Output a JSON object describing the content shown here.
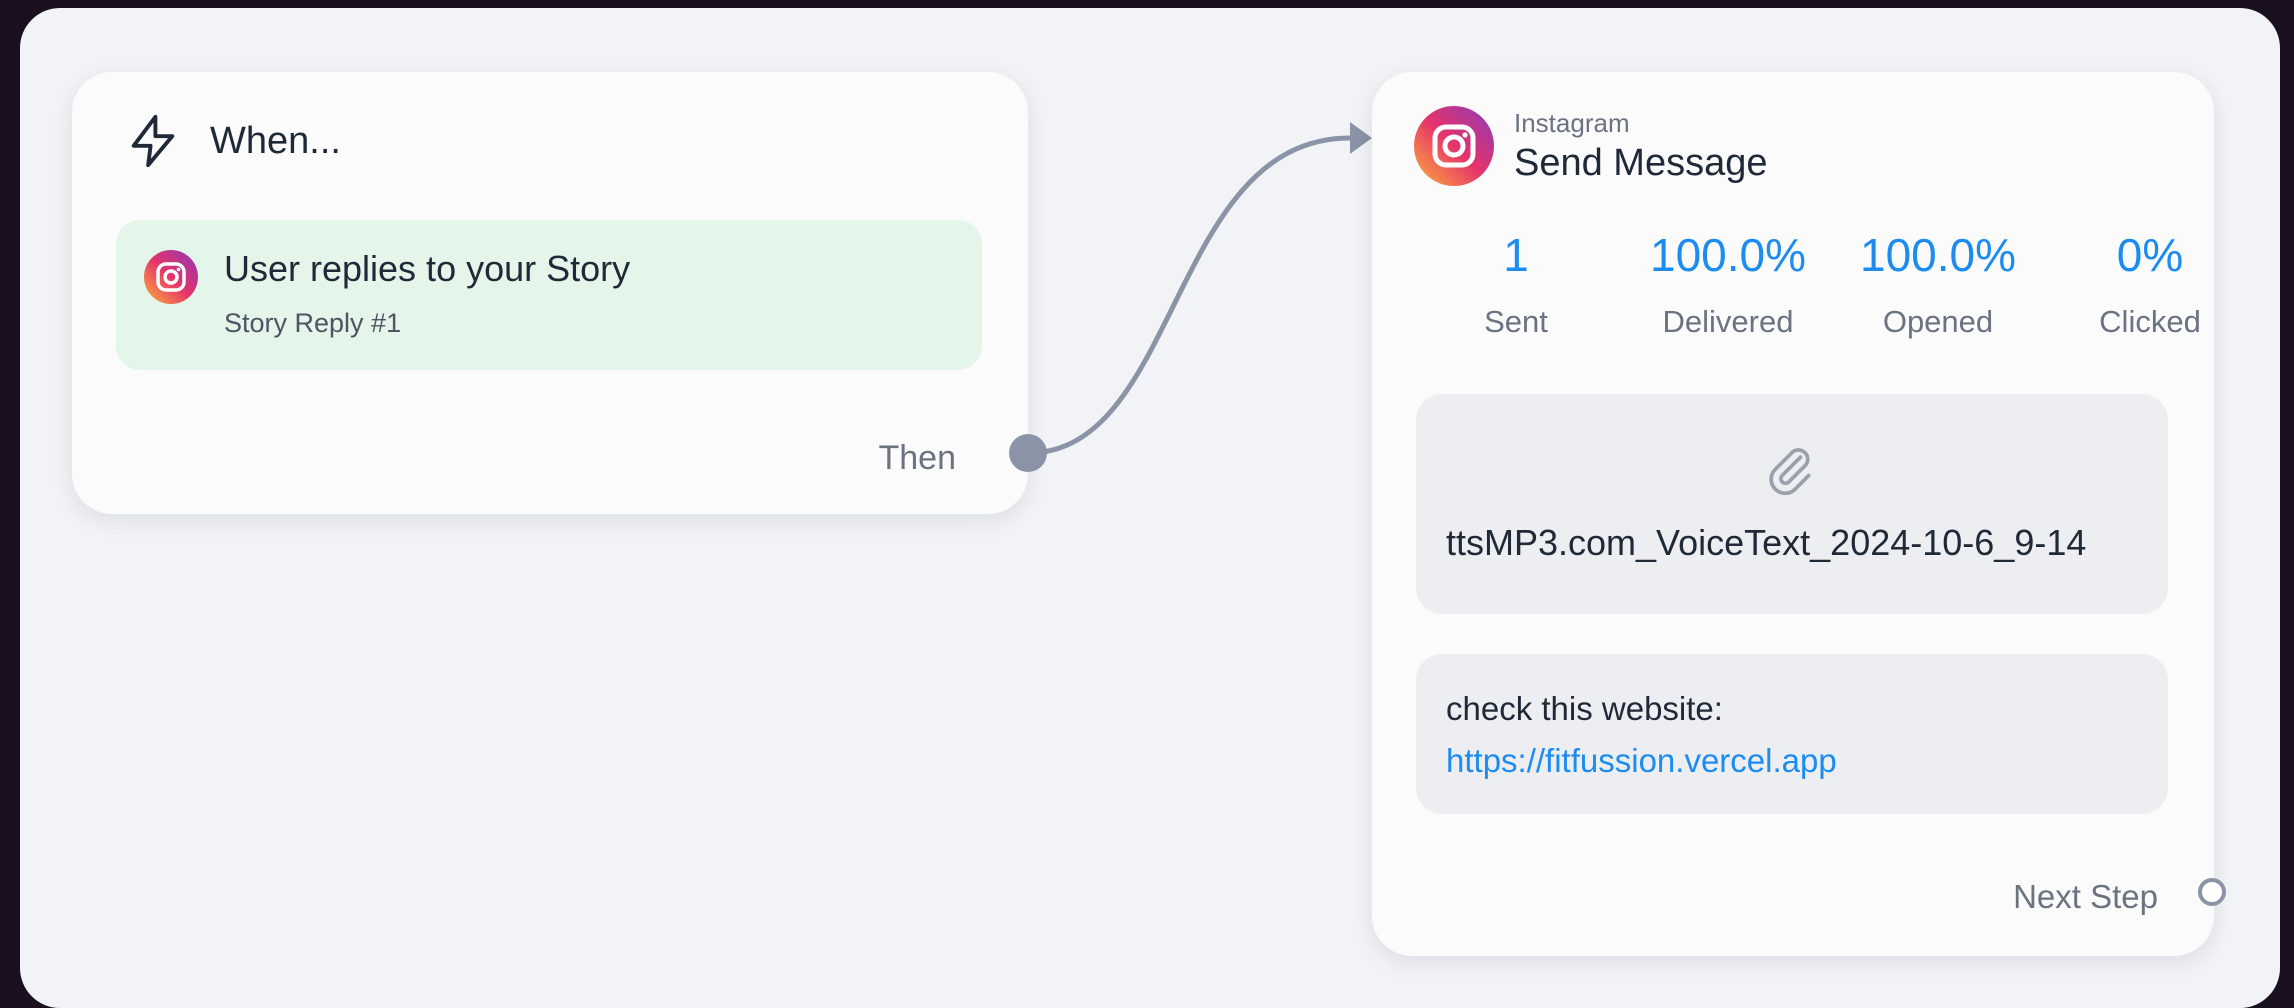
{
  "trigger": {
    "heading": "When...",
    "item": {
      "title": "User replies to your Story",
      "subtitle": "Story Reply #1"
    },
    "connector_label": "Then"
  },
  "action": {
    "platform": "Instagram",
    "title": "Send Message",
    "stats": [
      {
        "value": "1",
        "label": "Sent"
      },
      {
        "value": "100.0%",
        "label": "Delivered"
      },
      {
        "value": "100.0%",
        "label": "Opened"
      },
      {
        "value": "0%",
        "label": "Clicked"
      }
    ],
    "attachment": {
      "file_name": "ttsMP3.com_VoiceText_2024-10-6_9-14"
    },
    "message": {
      "text": "check this website:",
      "link": "https://fitfussion.vercel.app"
    },
    "next_step_label": "Next Step"
  },
  "colors": {
    "accent_blue": "#1d8cf0",
    "trigger_item_bg": "#e3f6e9",
    "connector": "#8a94a6"
  },
  "icons": [
    "bolt-icon",
    "instagram-icon",
    "paperclip-icon"
  ]
}
